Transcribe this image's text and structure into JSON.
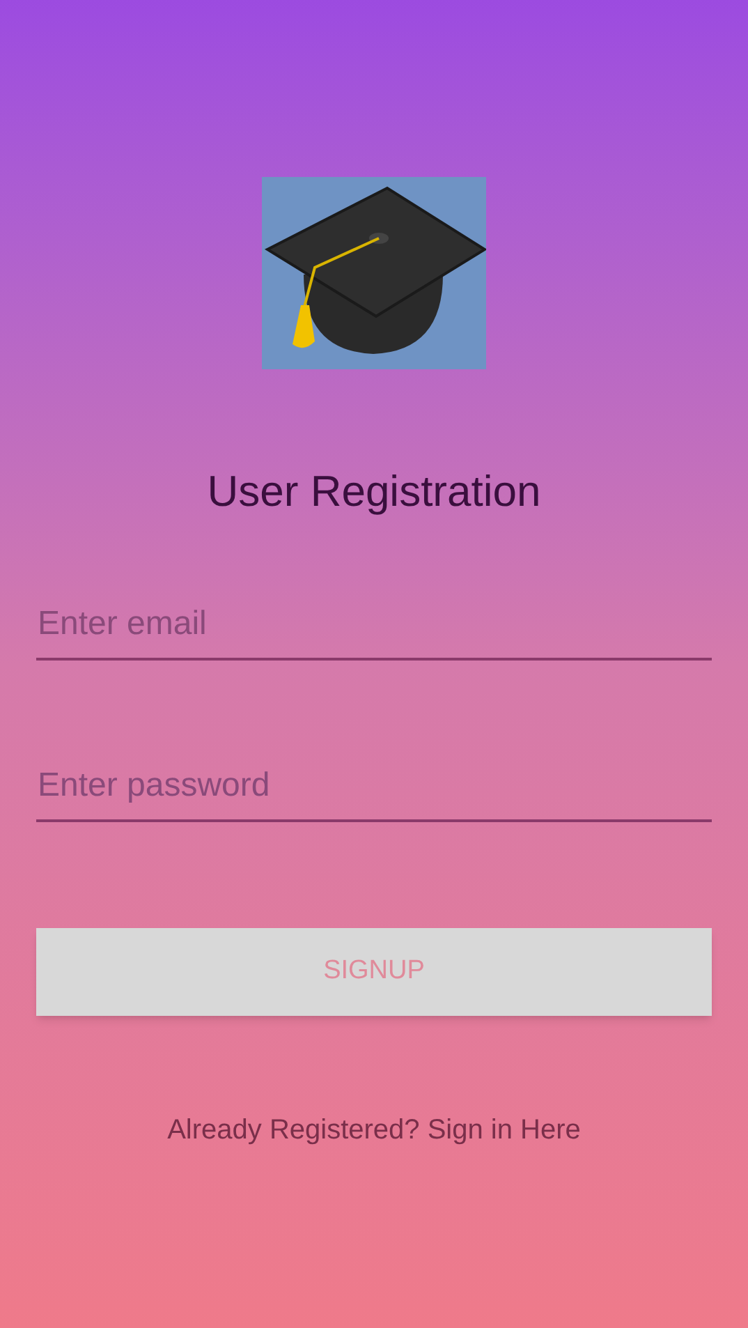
{
  "title": "User Registration",
  "fields": [
    {
      "placeholder": "Enter email"
    },
    {
      "placeholder": "Enter password"
    }
  ],
  "button": "SIGNUP",
  "link": "Already Registered? Sign in Here"
}
